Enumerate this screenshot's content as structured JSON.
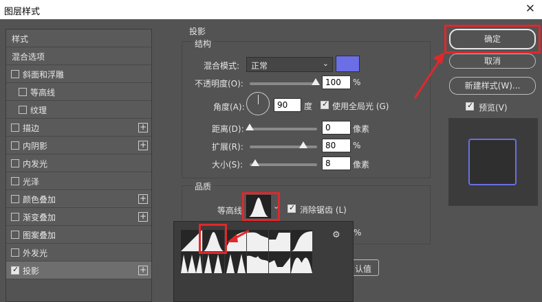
{
  "window": {
    "title": "图层样式",
    "close_glyph": "✕"
  },
  "left_panel": {
    "items": [
      {
        "label": "样式",
        "checkbox": false,
        "checked": false,
        "plus": false,
        "indent": false
      },
      {
        "label": "混合选项",
        "checkbox": false,
        "checked": false,
        "plus": false,
        "indent": false
      },
      {
        "label": "斜面和浮雕",
        "checkbox": true,
        "checked": false,
        "plus": false,
        "indent": false
      },
      {
        "label": "等高线",
        "checkbox": true,
        "checked": false,
        "plus": false,
        "indent": true
      },
      {
        "label": "纹理",
        "checkbox": true,
        "checked": false,
        "plus": false,
        "indent": true
      },
      {
        "label": "描边",
        "checkbox": true,
        "checked": false,
        "plus": true,
        "indent": false
      },
      {
        "label": "内阴影",
        "checkbox": true,
        "checked": false,
        "plus": true,
        "indent": false
      },
      {
        "label": "内发光",
        "checkbox": true,
        "checked": false,
        "plus": false,
        "indent": false
      },
      {
        "label": "光泽",
        "checkbox": true,
        "checked": false,
        "plus": false,
        "indent": false
      },
      {
        "label": "颜色叠加",
        "checkbox": true,
        "checked": false,
        "plus": true,
        "indent": false
      },
      {
        "label": "渐变叠加",
        "checkbox": true,
        "checked": false,
        "plus": true,
        "indent": false
      },
      {
        "label": "图案叠加",
        "checkbox": true,
        "checked": false,
        "plus": false,
        "indent": false
      },
      {
        "label": "外发光",
        "checkbox": true,
        "checked": false,
        "plus": false,
        "indent": false
      },
      {
        "label": "投影",
        "checkbox": true,
        "checked": true,
        "plus": true,
        "indent": false
      }
    ],
    "plus_glyph": "+"
  },
  "drop_shadow": {
    "section_title": "投影",
    "structure": {
      "title": "结构",
      "blend_mode_label": "混合模式:",
      "blend_mode_value": "正常",
      "shadow_color": "#6a6fe6",
      "opacity_label": "不透明度(O):",
      "opacity_value": "100",
      "opacity_unit": "%",
      "angle_label": "角度(A):",
      "angle_value": "90",
      "angle_unit": "度",
      "global_light_label": "使用全局光 (G)",
      "distance_label": "距离(D):",
      "distance_value": "0",
      "distance_unit": "像素",
      "spread_label": "扩展(R):",
      "spread_value": "80",
      "spread_unit": "%",
      "size_label": "大小(S):",
      "size_value": "8",
      "size_unit": "像素"
    },
    "quality": {
      "title": "品质",
      "contour_label": "等高线:",
      "anti_alias_label": "消除锯齿 (L)",
      "noise_unit": "%",
      "default_button_partial": "认值",
      "gear_glyph": "⚙"
    }
  },
  "buttons": {
    "ok": "确定",
    "cancel": "取消",
    "new_style": "新建样式(W)...",
    "preview_label": "预览(V)"
  },
  "chevron_glyph": "⌄"
}
